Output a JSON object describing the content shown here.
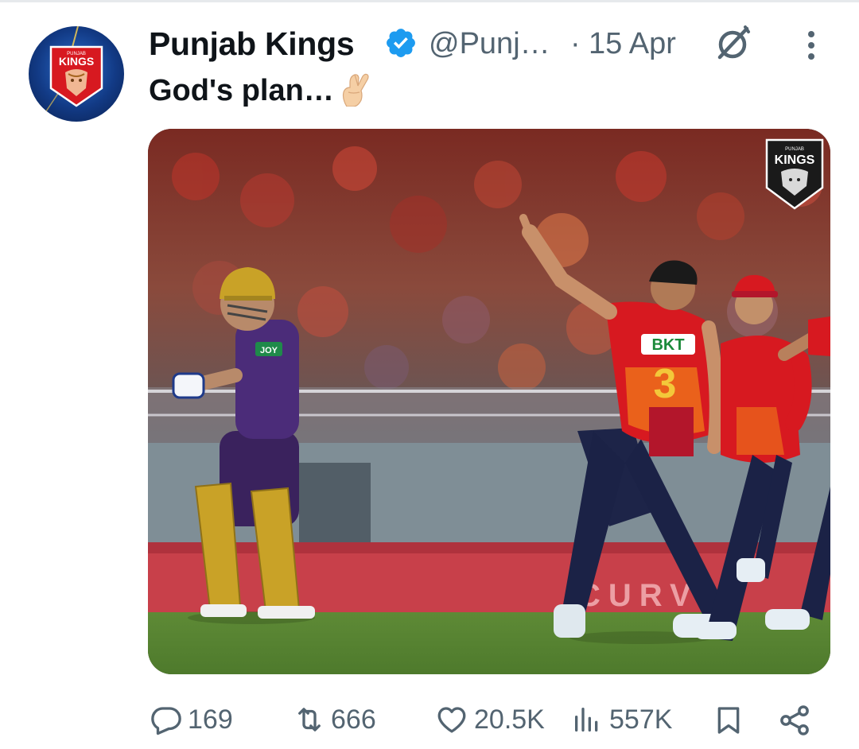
{
  "account": {
    "display_name": "Punjab Kings",
    "handle": "@Punj…",
    "separator": "·",
    "date": "15 Apr",
    "verified": true,
    "avatar_text": "KINGS",
    "avatar_small_text": "PUNJAB"
  },
  "tweet": {
    "text": "God's plan…",
    "emoji": "crossed-fingers-emoji"
  },
  "media": {
    "watermark_top": "PUNJAB",
    "watermark_main": "KINGS",
    "jersey_sponsor": "BKT",
    "jersey_number": "3",
    "batter_sponsor": "JOY",
    "board_text": "CURV"
  },
  "actions": {
    "replies": "169",
    "reposts": "666",
    "likes": "20.5K",
    "views": "557K"
  },
  "colors": {
    "text_primary": "#0f1419",
    "text_secondary": "#536471",
    "verified_blue": "#1d9bf0",
    "pbks_red": "#d71920",
    "kkr_purple": "#3a225d"
  }
}
